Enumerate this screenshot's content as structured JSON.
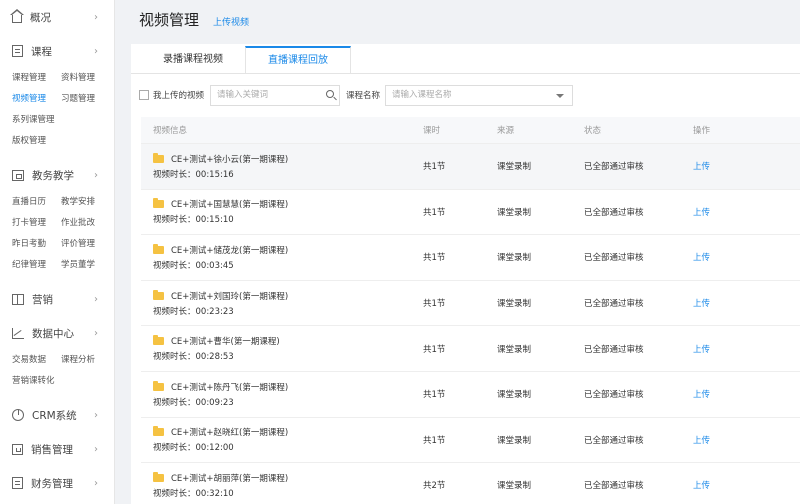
{
  "sidebar": {
    "sections": [
      {
        "label": "概况",
        "icon": "home-icon",
        "items": []
      },
      {
        "label": "课程",
        "icon": "document-icon",
        "items": [
          "课程管理",
          "资料管理",
          "视频管理",
          "习题管理",
          "系列课管理",
          "版权管理"
        ],
        "active": "视频管理"
      },
      {
        "label": "教务教学",
        "icon": "screen-icon",
        "items": [
          "直播日历",
          "教学安排",
          "打卡管理",
          "作业批改",
          "昨日考勤",
          "评价管理",
          "纪律管理",
          "学员董学"
        ]
      },
      {
        "label": "营销",
        "icon": "book-icon",
        "items": []
      },
      {
        "label": "数据中心",
        "icon": "chart-icon",
        "items": [
          "交易数据",
          "课程分析",
          "营销课转化"
        ]
      },
      {
        "label": "CRM系统",
        "icon": "pie-icon",
        "items": []
      },
      {
        "label": "销售管理",
        "icon": "bag-icon",
        "items": []
      },
      {
        "label": "财务管理",
        "icon": "doc-icon",
        "items": []
      }
    ]
  },
  "header": {
    "title": "视频管理",
    "upload_link": "上传视频"
  },
  "tabs": [
    "录播课程视频",
    "直播课程回放"
  ],
  "active_tab": 1,
  "filters": {
    "my_upload_label": "我上传的视频",
    "search_placeholder": "请输入关键词",
    "course_label": "课程名称",
    "course_placeholder": "请输入课程名称"
  },
  "table": {
    "columns": [
      "视频信息",
      "课时",
      "来源",
      "状态",
      "操作"
    ],
    "rows": [
      {
        "name": "CE+测试+徐小云(第一期课程)",
        "duration": "视频时长：00:15:16",
        "lessons": "共1节",
        "source": "课堂录制",
        "status": "已全部通过审核",
        "action": "上传"
      },
      {
        "name": "CE+测试+国慧慧(第一期课程)",
        "duration": "视频时长：00:15:10",
        "lessons": "共1节",
        "source": "课堂录制",
        "status": "已全部通过审核",
        "action": "上传"
      },
      {
        "name": "CE+测试+储茂龙(第一期课程)",
        "duration": "视频时长：00:03:45",
        "lessons": "共1节",
        "source": "课堂录制",
        "status": "已全部通过审核",
        "action": "上传"
      },
      {
        "name": "CE+测试+刘国玲(第一期课程)",
        "duration": "视频时长：00:23:23",
        "lessons": "共1节",
        "source": "课堂录制",
        "status": "已全部通过审核",
        "action": "上传"
      },
      {
        "name": "CE+测试+曹华(第一期课程)",
        "duration": "视频时长：00:28:53",
        "lessons": "共1节",
        "source": "课堂录制",
        "status": "已全部通过审核",
        "action": "上传"
      },
      {
        "name": "CE+测试+陈丹飞(第一期课程)",
        "duration": "视频时长：00:09:23",
        "lessons": "共1节",
        "source": "课堂录制",
        "status": "已全部通过审核",
        "action": "上传"
      },
      {
        "name": "CE+测试+赵晓红(第一期课程)",
        "duration": "视频时长：00:12:00",
        "lessons": "共1节",
        "source": "课堂录制",
        "status": "已全部通过审核",
        "action": "上传"
      },
      {
        "name": "CE+测试+胡丽萍(第一期课程)",
        "duration": "视频时长：00:32:10",
        "lessons": "共2节",
        "source": "课堂录制",
        "status": "已全部通过审核",
        "action": "上传"
      }
    ]
  }
}
